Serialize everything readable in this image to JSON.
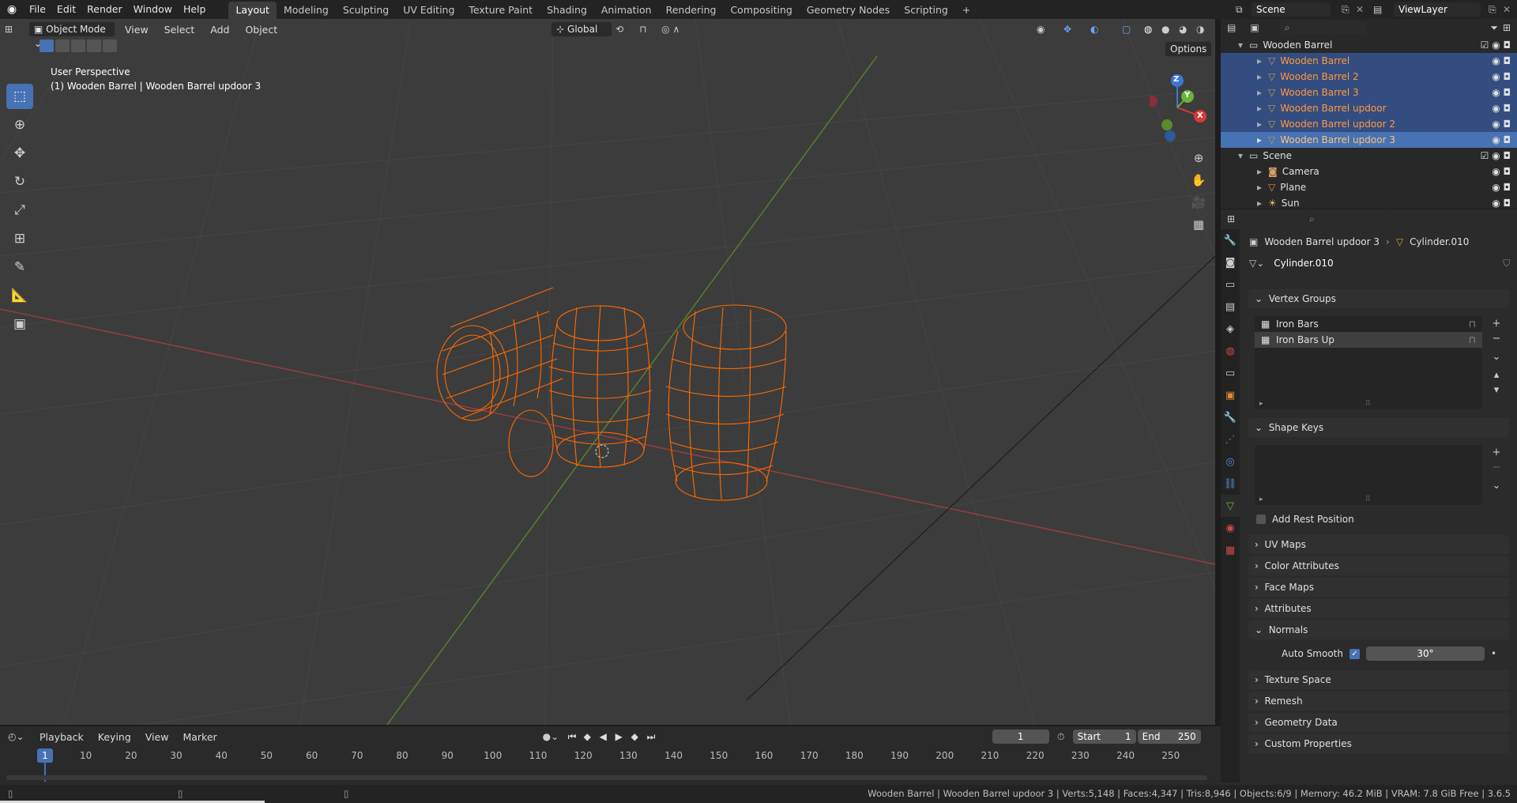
{
  "app": {
    "menu": [
      "File",
      "Edit",
      "Render",
      "Window",
      "Help"
    ]
  },
  "workspaces": [
    "Layout",
    "Modeling",
    "Sculpting",
    "UV Editing",
    "Texture Paint",
    "Shading",
    "Animation",
    "Rendering",
    "Compositing",
    "Geometry Nodes",
    "Scripting"
  ],
  "scene": "Scene",
  "view_layer": "ViewLayer",
  "viewport": {
    "mode": "Object Mode",
    "menus": [
      "View",
      "Select",
      "Add",
      "Object"
    ],
    "orientation": "Global",
    "options": "Options",
    "perspective_label": "User Perspective",
    "context_label": "(1) Wooden Barrel | Wooden Barrel updoor 3",
    "gizmo": {
      "x": "X",
      "y": "Y",
      "z": "Z"
    }
  },
  "outliner": {
    "collection": "Wooden Barrel",
    "items": [
      "Wooden Barrel",
      "Wooden Barrel 2",
      "Wooden Barrel 3",
      "Wooden Barrel updoor",
      "Wooden Barrel updoor 2",
      "Wooden Barrel updoor 3"
    ],
    "scene_collection": "Scene",
    "scene_items": [
      "Camera",
      "Plane",
      "Sun"
    ]
  },
  "properties": {
    "object": "Wooden Barrel updoor 3",
    "mesh": "Cylinder.010",
    "datablock": "Cylinder.010",
    "vertex_groups_title": "Vertex Groups",
    "vertex_groups": [
      "Iron Bars",
      "Iron Bars Up"
    ],
    "shape_keys_title": "Shape Keys",
    "add_rest_position": "Add Rest Position",
    "panels": [
      "UV Maps",
      "Color Attributes",
      "Face Maps",
      "Attributes"
    ],
    "normals": "Normals",
    "auto_smooth": "Auto Smooth",
    "auto_smooth_angle": "30°",
    "panels2": [
      "Texture Space",
      "Remesh",
      "Geometry Data",
      "Custom Properties"
    ]
  },
  "timeline": {
    "menus": [
      "Playback",
      "Keying",
      "View",
      "Marker"
    ],
    "current_frame": "1",
    "start_label": "Start",
    "start": "1",
    "end_label": "End",
    "end": "250",
    "ticks": [
      "10",
      "20",
      "30",
      "40",
      "50",
      "60",
      "70",
      "80",
      "90",
      "100",
      "110",
      "120",
      "130",
      "140",
      "150",
      "160",
      "170",
      "180",
      "190",
      "200",
      "210",
      "220",
      "230",
      "240",
      "250"
    ],
    "current_tick": "1"
  },
  "status": "Wooden Barrel | Wooden Barrel updoor 3 | Verts:5,148 | Faces:4,347 | Tris:8,946 | Objects:6/9 | Memory: 46.2 MiB | VRAM: 7.8 GiB Free | 3.6.5",
  "colors": {
    "accent": "#4772b3",
    "selected_orange": "#ff7a1a",
    "wire": "#ff6a00"
  }
}
